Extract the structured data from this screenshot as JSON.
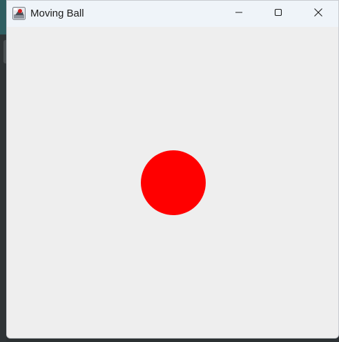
{
  "window": {
    "title": "Moving Ball",
    "app_icon": "java-app-icon",
    "controls": {
      "minimize_icon": "minimize-icon",
      "maximize_icon": "maximize-icon",
      "close_icon": "close-icon"
    }
  },
  "canvas": {
    "background_color": "#eeeeee",
    "ball": {
      "color": "#ff0000",
      "shape": "circle"
    }
  }
}
